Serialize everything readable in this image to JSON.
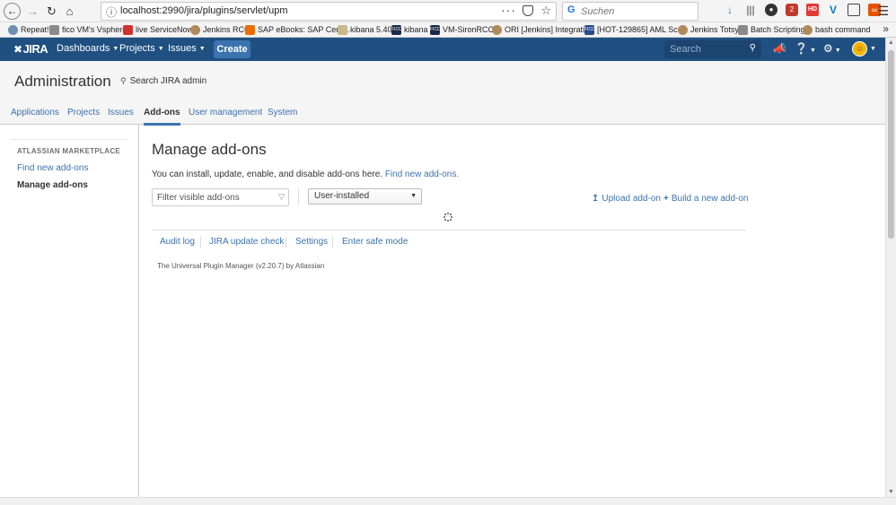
{
  "browser": {
    "url": "localhost:2990/jira/plugins/servlet/upm",
    "search_placeholder": "Suchen",
    "icons": [
      "back-icon",
      "forward-icon",
      "reload-icon",
      "home-icon",
      "page-actions-icon",
      "pocket-icon",
      "bookmark-star-icon",
      "download-icon",
      "library-icon",
      "extension-icon",
      "adblock-icon",
      "extension-red-icon",
      "vpn-icon",
      "sidebar-icon",
      "extension-orange-icon",
      "menu-icon"
    ],
    "adblock_badge": "2"
  },
  "bookmarks": [
    {
      "label": "Repeat!"
    },
    {
      "label": "fico VM's Vsphere"
    },
    {
      "label": "live ServiceNow"
    },
    {
      "label": "Jenkins RCC"
    },
    {
      "label": "SAP eBooks: SAP Certi..."
    },
    {
      "label": "kibana 5.40"
    },
    {
      "label": "kibana"
    },
    {
      "label": "VM-SironRCC"
    },
    {
      "label": "ORI [Jenkins] Integrati..."
    },
    {
      "label": "[HOT-129865] AML Sc..."
    },
    {
      "label": "Jenkins Totsy"
    },
    {
      "label": "Batch Scripting"
    },
    {
      "label": "bash command"
    }
  ],
  "header": {
    "logo": "JIRA",
    "nav": {
      "dashboards": "Dashboards",
      "projects": "Projects",
      "issues": "Issues"
    },
    "create": "Create",
    "search_placeholder": "Search",
    "colors": {
      "header_bg": "#205081",
      "create_bg": "#3b73af",
      "link": "#3b73af"
    }
  },
  "admin": {
    "title": "Administration",
    "search": "Search JIRA admin",
    "tabs": {
      "applications": "Applications",
      "projects": "Projects",
      "issues": "Issues",
      "addons": "Add-ons",
      "user_management": "User management",
      "system": "System"
    },
    "active_tab": "Add-ons"
  },
  "sidebar": {
    "heading": "ATLASSIAN MARKETPLACE",
    "find": "Find new add-ons",
    "manage": "Manage add-ons"
  },
  "main": {
    "title": "Manage add-ons",
    "intro": "You can install, update, enable, and disable add-ons here.",
    "intro_link": "Find new add-ons.",
    "filter_placeholder": "Filter visible add-ons",
    "select_value": "User-installed",
    "upload": "Upload add-on",
    "build": "Build a new add-on",
    "footer": {
      "audit": "Audit log",
      "update": "JIRA update check",
      "settings": "Settings",
      "safe": "Enter safe mode"
    },
    "version": "The Universal Plugin Manager (v2.20.7) by Atlassian"
  }
}
